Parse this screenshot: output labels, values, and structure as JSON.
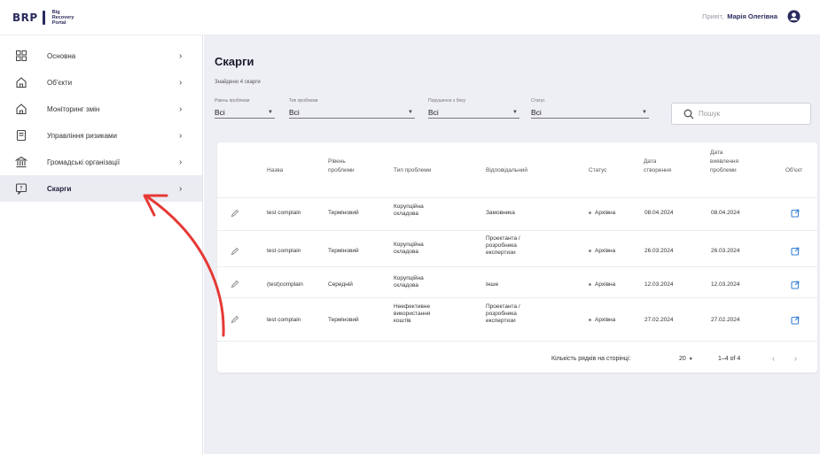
{
  "header": {
    "logo_mark": "BRP",
    "logo_lines": [
      "Big",
      "Recovery",
      "Portal"
    ],
    "greeting_prefix": "Привіт,",
    "user_name": "Марія Олегівна"
  },
  "sidebar": {
    "items": [
      {
        "label": "Основна",
        "icon": "grid-icon"
      },
      {
        "label": "Об'єкти",
        "icon": "home-icon"
      },
      {
        "label": "Моніторинг змін",
        "icon": "home-icon"
      },
      {
        "label": "Управління ризиками",
        "icon": "document-icon"
      },
      {
        "label": "Громадські організації",
        "icon": "building-icon"
      },
      {
        "label": "Скарги",
        "icon": "message-alert-icon",
        "active": true
      }
    ]
  },
  "main": {
    "title": "Скарги",
    "found_text": "Знайдено 4 скарги",
    "filters": [
      {
        "label": "Рівень проблеми",
        "value": "Всі"
      },
      {
        "label": "Тип проблеми",
        "value": "Всі"
      },
      {
        "label": "Порушення з боку",
        "value": "Всі"
      },
      {
        "label": "Статус",
        "value": "Всі"
      }
    ],
    "search_placeholder": "Пошук"
  },
  "table": {
    "columns": [
      "Назва",
      "Рівень\nпроблеми",
      "Тип проблеми",
      "Відповідальний",
      "Статус",
      "Дата\nстворення",
      "Дата\nвиявлення\nпроблеми",
      "Об'єкт"
    ],
    "rows": [
      {
        "name": "test complain",
        "level": "Терміновий",
        "type": "Корупційна\nскладова",
        "responsible": "Замовника",
        "status": "Архівна",
        "created": "08.04.2024",
        "detected": "08.04.2024"
      },
      {
        "name": "test complain",
        "level": "Терміновий",
        "type": "Корупційна\nскладова",
        "responsible": "Проектанта /\nрозробника\nекспертизи",
        "status": "Архівна",
        "created": "26.03.2024",
        "detected": "26.03.2024"
      },
      {
        "name": "(test)complain",
        "level": "Середній",
        "type": "Корупційна\nскладова",
        "responsible": "Інше",
        "status": "Архівна",
        "created": "12.03.2024",
        "detected": "12.03.2024"
      },
      {
        "name": "test complain",
        "level": "Терміновий",
        "type": "Неефективне\nвикористання\nкоштів",
        "responsible": "Проектанта /\nрозробника\nекспертизи",
        "status": "Архівна",
        "created": "27.02.2024",
        "detected": "27.02.2024"
      }
    ],
    "footer": {
      "rows_per_page_label": "Кількість рядків на сторінці:",
      "rows_per_page": "20",
      "range": "1–4 of 4"
    }
  },
  "colors": {
    "brand": "#2b2b5e",
    "accent": "#3b82d6",
    "annotation": "#e53935",
    "background": "#eeeef5"
  }
}
